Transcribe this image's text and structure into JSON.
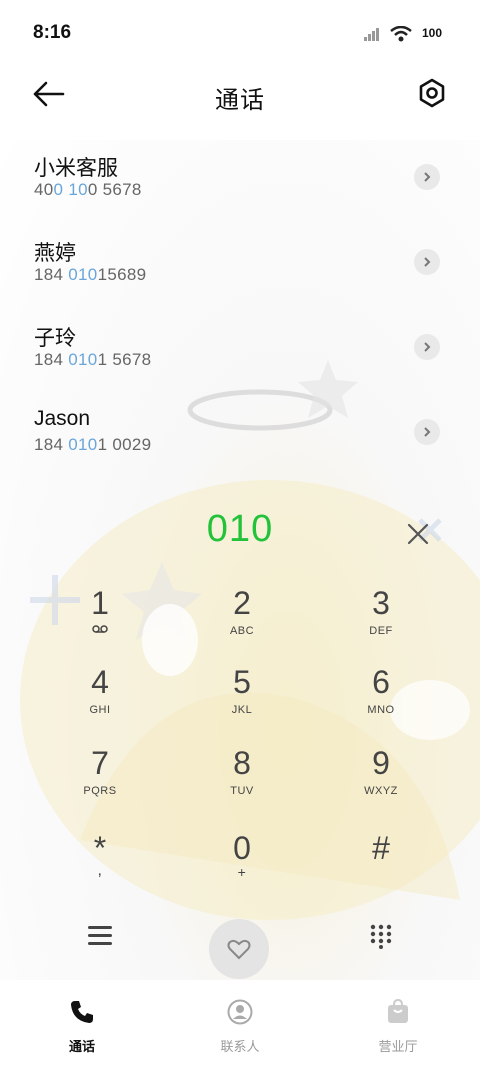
{
  "status": {
    "time": "8:16",
    "battery": "100"
  },
  "header": {
    "title": "通话"
  },
  "calllog": [
    {
      "name": "小米客服",
      "number_pre": "40",
      "number_hl1": "0",
      "number_mid": " ",
      "number_hl2": "10",
      "number_post": "0 5678"
    },
    {
      "name": "燕婷",
      "number_pre": "184 ",
      "number_hl1": "010",
      "number_mid": "",
      "number_hl2": "",
      "number_post": "15689"
    },
    {
      "name": "子玲",
      "number_pre": "184 ",
      "number_hl1": "010",
      "number_mid": "",
      "number_hl2": "",
      "number_post": "1 5678"
    },
    {
      "name": "Jason",
      "number_pre": "184 ",
      "number_hl1": "010",
      "number_mid": "",
      "number_hl2": "",
      "number_post": "1 0029"
    }
  ],
  "dialer": {
    "input": "010",
    "keys": [
      {
        "digit": "1",
        "letters": ""
      },
      {
        "digit": "2",
        "letters": "ABC"
      },
      {
        "digit": "3",
        "letters": "DEF"
      },
      {
        "digit": "4",
        "letters": "GHI"
      },
      {
        "digit": "5",
        "letters": "JKL"
      },
      {
        "digit": "6",
        "letters": "MNO"
      },
      {
        "digit": "7",
        "letters": "PQRS"
      },
      {
        "digit": "8",
        "letters": "TUV"
      },
      {
        "digit": "9",
        "letters": "WXYZ"
      },
      {
        "digit": "*",
        "letters": ","
      },
      {
        "digit": "0",
        "letters": "+"
      },
      {
        "digit": "#",
        "letters": ""
      }
    ]
  },
  "tabs": [
    {
      "label": "通话",
      "icon": "phone-icon",
      "active": true
    },
    {
      "label": "联系人",
      "icon": "person-icon",
      "active": false
    },
    {
      "label": "营业厅",
      "icon": "bag-icon",
      "active": false
    }
  ],
  "colors": {
    "accent_green": "#22c23a",
    "match_blue": "#6aa6d9"
  }
}
